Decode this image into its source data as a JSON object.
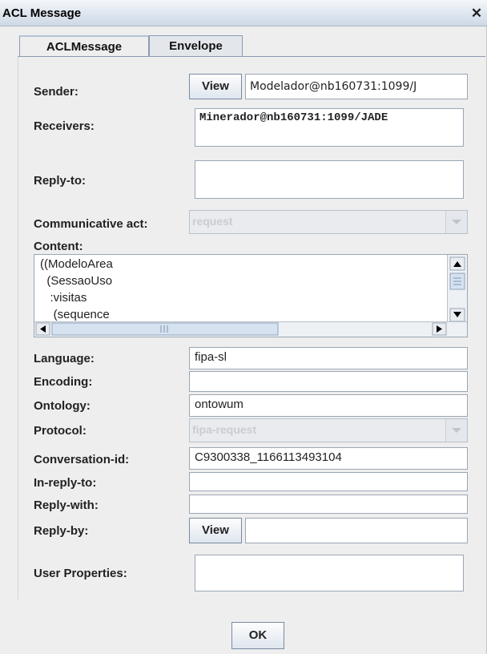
{
  "window": {
    "title": "ACL Message",
    "close_glyph": "✕"
  },
  "tabs": [
    {
      "label": "ACLMessage"
    },
    {
      "label": "Envelope"
    }
  ],
  "sender": {
    "label": "Sender:",
    "button": "View",
    "value": "Modelador@nb160731:1099/J"
  },
  "receivers": {
    "label": "Receivers:",
    "value": "Minerador@nb160731:1099/JADE"
  },
  "reply_to": {
    "label": "Reply-to:",
    "value": ""
  },
  "communicative_act": {
    "label": "Communicative act:",
    "value": "request"
  },
  "content": {
    "label": "Content:",
    "lines": [
      "((ModeloArea",
      "  (SessaoUso",
      "   :visitas",
      "    (sequence"
    ]
  },
  "language": {
    "label": "Language:",
    "value": "fipa-sl"
  },
  "encoding": {
    "label": "Encoding:",
    "value": ""
  },
  "ontology": {
    "label": "Ontology:",
    "value": "ontowum"
  },
  "protocol": {
    "label": "Protocol:",
    "value": "fipa-request"
  },
  "conversation_id": {
    "label": "Conversation-id:",
    "value": "C9300338_1166113493104"
  },
  "in_reply_to": {
    "label": "In-reply-to:",
    "value": ""
  },
  "reply_with": {
    "label": "Reply-with:",
    "value": ""
  },
  "reply_by": {
    "label": "Reply-by:",
    "button": "View",
    "value": ""
  },
  "user_properties": {
    "label": "User Properties:",
    "value": ""
  },
  "footer": {
    "ok_label": "OK"
  },
  "colors": {
    "title_gradient_top": "#f4f7fb",
    "title_gradient_bottom": "#cfd9e6",
    "window_bg": "#eeeeee",
    "disabled_text": "#c9ccd1"
  },
  "icons": {
    "close": "close-icon",
    "scroll_up": "arrow-up-icon",
    "scroll_down": "arrow-down-icon",
    "scroll_left": "arrow-left-icon",
    "scroll_right": "arrow-right-icon",
    "combo": "chevron-down-icon"
  }
}
